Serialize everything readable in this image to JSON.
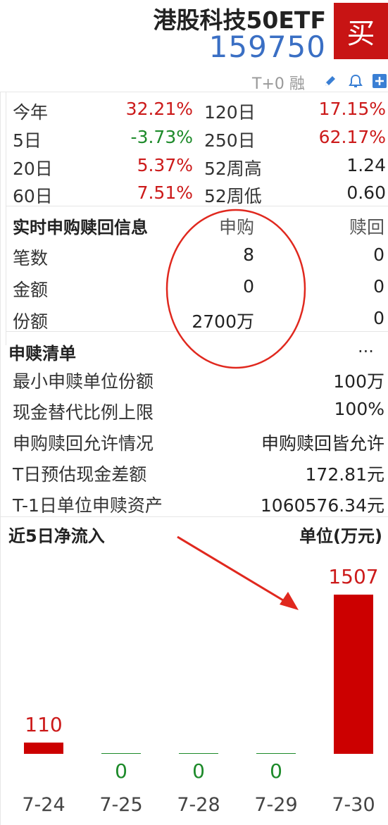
{
  "header": {
    "fund_name": "港股科技50ETF",
    "fund_code": "159750",
    "buy_label": "买",
    "trade_flags": "T+0 融"
  },
  "returns": [
    {
      "label": "今年",
      "value": "32.21%",
      "color": "red"
    },
    {
      "label": "120日",
      "value": "17.15%",
      "color": "red"
    },
    {
      "label": "5日",
      "value": "-3.73%",
      "color": "green"
    },
    {
      "label": "250日",
      "value": "62.17%",
      "color": "red"
    },
    {
      "label": "20日",
      "value": "5.37%",
      "color": "red"
    },
    {
      "label": "52周高",
      "value": "1.24",
      "color": "black"
    },
    {
      "label": "60日",
      "value": "7.51%",
      "color": "red"
    },
    {
      "label": "52周低",
      "value": "0.60",
      "color": "black"
    }
  ],
  "realtime": {
    "title": "实时申购赎回信息",
    "col_subscribe": "申购",
    "col_redeem": "赎回",
    "rows": [
      {
        "label": "笔数",
        "subscribe": "8",
        "redeem": "0"
      },
      {
        "label": "金额",
        "subscribe": "0",
        "redeem": "0"
      },
      {
        "label": "份额",
        "subscribe": "2700万",
        "redeem": "0"
      }
    ]
  },
  "list": {
    "title": "申赎清单",
    "more": "...",
    "rows": [
      {
        "label": "最小申赎单位份额",
        "value": "100万"
      },
      {
        "label": "现金替代比例上限",
        "value": "100%"
      },
      {
        "label": "申购赎回允许情况",
        "value": "申购赎回皆允许"
      },
      {
        "label": "T日预估现金差额",
        "value": "172.81元"
      },
      {
        "label": "T-1日单位申赎资产",
        "value": "1060576.34元"
      }
    ]
  },
  "flow": {
    "title": "近5日净流入",
    "unit": "单位(万元)"
  },
  "colors": {
    "red": "#cc1a1a",
    "green": "#1d8a2a",
    "bar_red": "#cc0000",
    "bar_green": "#1d8a2a",
    "annotation": "#e0281e"
  },
  "chart_data": {
    "type": "bar",
    "categories": [
      "7-24",
      "7-25",
      "7-28",
      "7-29",
      "7-30"
    ],
    "values": [
      110,
      0,
      0,
      0,
      1507
    ],
    "value_labels": [
      "110",
      "0",
      "0",
      "0",
      "1507"
    ],
    "title": "近5日净流入",
    "unit": "单位(万元)"
  }
}
